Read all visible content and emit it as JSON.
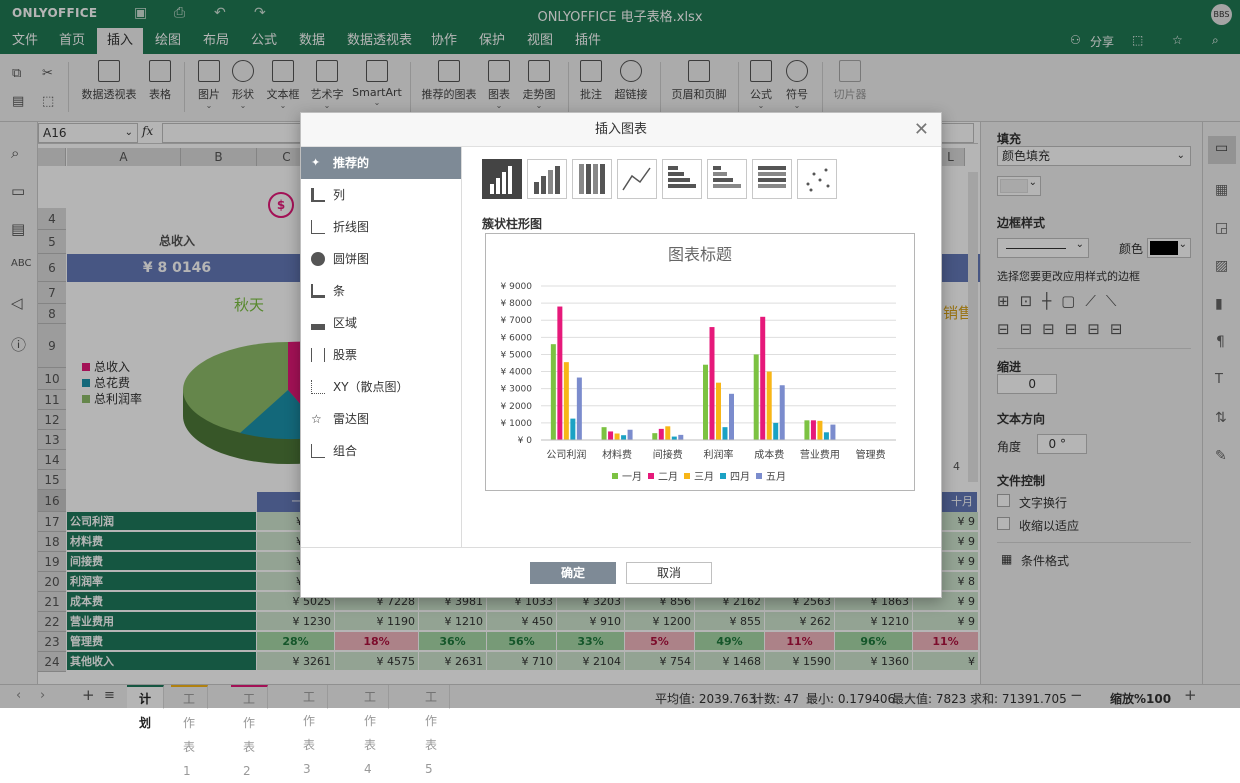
{
  "titlebar": {
    "logo": "ONLYOFFICE",
    "title": "ONLYOFFICE 电子表格.xlsx",
    "avatar": "BBS"
  },
  "menu": [
    "文件",
    "首页",
    "插入",
    "绘图",
    "布局",
    "公式",
    "数据",
    "数据透视表",
    "协作",
    "保护",
    "视图",
    "插件"
  ],
  "menu_active": "插入",
  "menu_right": {
    "share": "分享"
  },
  "ribbon": [
    {
      "label": "数据透视表",
      "chev": ""
    },
    {
      "label": "表格",
      "chev": ""
    },
    {
      "label": "图片",
      "chev": "⌄"
    },
    {
      "label": "形状",
      "chev": "⌄"
    },
    {
      "label": "文本框",
      "chev": "⌄"
    },
    {
      "label": "艺术字",
      "chev": "⌄"
    },
    {
      "label": "SmartArt",
      "chev": "⌄"
    },
    {
      "label": "推荐的图表",
      "chev": ""
    },
    {
      "label": "图表",
      "chev": "⌄"
    },
    {
      "label": "走势图",
      "chev": "⌄"
    },
    {
      "label": "批注",
      "chev": ""
    },
    {
      "label": "超链接",
      "chev": ""
    },
    {
      "label": "页眉和页脚",
      "chev": ""
    },
    {
      "label": "公式",
      "chev": "⌄"
    },
    {
      "label": "符号",
      "chev": "⌄"
    },
    {
      "label": "切片器",
      "chev": ""
    }
  ],
  "formula": {
    "cell": "A16",
    "fx": "fx"
  },
  "sheet": {
    "cols": [
      "A",
      "B",
      "C",
      "L"
    ],
    "rows": [
      "4",
      "5",
      "6",
      "7",
      "8",
      "9",
      "10",
      "11",
      "12",
      "13",
      "14",
      "15",
      "16",
      "17",
      "18",
      "19",
      "20",
      "21",
      "22",
      "23",
      "24"
    ],
    "total_label": "总收入",
    "total_value": "¥ 8 0146",
    "season": "秋天",
    "legend": [
      "总收入",
      "总花费",
      "总利润率"
    ],
    "right_label": "销售",
    "right_num": "4",
    "table_labels": [
      "公司利润",
      "材料费",
      "间接费",
      "利润率",
      "成本费",
      "营业费用",
      "管理费",
      "其他收入"
    ],
    "row21": [
      "¥ 5025",
      "¥ 7228",
      "¥ 3981",
      "¥ 1033",
      "¥ 3203",
      "¥ 856",
      "¥ 2162",
      "¥ 2563",
      "¥ 1863",
      "¥ 9"
    ],
    "row22": [
      "¥ 1230",
      "¥ 1190",
      "¥ 1210",
      "¥ 450",
      "¥ 910",
      "¥ 1200",
      "¥ 855",
      "¥ 262",
      "¥ 1210",
      "¥ 9"
    ],
    "row23": [
      "28%",
      "18%",
      "36%",
      "56%",
      "33%",
      "5%",
      "49%",
      "11%",
      "96%",
      "11%"
    ],
    "row24": [
      "¥ 3261",
      "¥ 4575",
      "¥ 2631",
      "¥ 710",
      "¥ 2104",
      "¥ 754",
      "¥ 1468",
      "¥ 1590",
      "¥ 1360",
      "¥"
    ],
    "col_stub_header": "一",
    "right_header": "十月",
    "stub_values": [
      "¥",
      "¥",
      "¥",
      "¥"
    ],
    "right_values": [
      "¥ 9",
      "¥ 9",
      "¥ 9",
      "¥ 8"
    ]
  },
  "right_panel": {
    "fill": "填充",
    "fill_type": "颜色填充",
    "border_style": "边框样式",
    "color": "颜色",
    "border_hint": "选择您要更改应用样式的边框",
    "indent": "缩进",
    "indent_value": "0",
    "text_dir": "文本方向",
    "angle": "角度",
    "angle_value": "0 °",
    "text_control": "文件控制",
    "wrap": "文字换行",
    "shrink": "收缩以适应",
    "cond_format": "条件格式"
  },
  "status": {
    "tabs": [
      "计划",
      "工作表1",
      "工作表2",
      "工作表3",
      "工作表4",
      "工作表5"
    ],
    "average": "平均值: 2039.763",
    "count": "计数: 47",
    "min": "最小: 0.179406",
    "max": "最大值: 7823",
    "sum": "求和: 71391.705",
    "zoom": "缩放%100"
  },
  "dialog": {
    "title": "插入图表",
    "categories": [
      "推荐的",
      "列",
      "折线图",
      "圆饼图",
      "条",
      "区域",
      "股票",
      "XY（散点图）",
      "雷达图",
      "组合"
    ],
    "active_category": "推荐的",
    "subtype_label": "簇状柱形图",
    "ok": "确定",
    "cancel": "取消"
  },
  "chart_data": {
    "type": "bar",
    "title": "图表标题",
    "categories": [
      "公司利润",
      "材料费",
      "间接费",
      "利润率",
      "成本费",
      "营业费用",
      "管理费"
    ],
    "ylim": [
      0,
      9000
    ],
    "yticks": [
      "¥ 0",
      "¥ 1000",
      "¥ 2000",
      "¥ 3000",
      "¥ 4000",
      "¥ 5000",
      "¥ 6000",
      "¥ 7000",
      "¥ 8000",
      "¥ 9000"
    ],
    "grid": true,
    "legend": "bottom",
    "series": [
      {
        "name": "一月",
        "color": "#7cc242",
        "values": [
          5600,
          750,
          400,
          4400,
          5000,
          1150,
          0
        ]
      },
      {
        "name": "二月",
        "color": "#e6197a",
        "values": [
          7800,
          500,
          650,
          6600,
          7200,
          1150,
          0
        ]
      },
      {
        "name": "三月",
        "color": "#f8b617",
        "values": [
          4550,
          380,
          800,
          3350,
          4000,
          1120,
          0
        ]
      },
      {
        "name": "四月",
        "color": "#1ba2c4",
        "values": [
          1250,
          280,
          200,
          750,
          1000,
          450,
          0
        ]
      },
      {
        "name": "五月",
        "color": "#7b8ccd",
        "values": [
          3650,
          600,
          300,
          2700,
          3200,
          900,
          0
        ]
      }
    ]
  }
}
